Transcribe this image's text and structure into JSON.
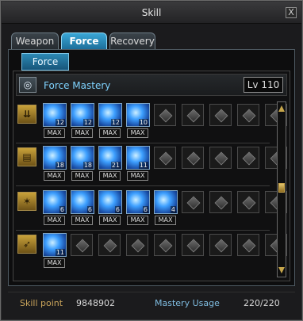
{
  "window": {
    "title": "Skill",
    "close_label": "X"
  },
  "tabs": [
    "Weapon",
    "Force",
    "Recovery"
  ],
  "subtab": "Force",
  "mastery": {
    "name": "Force Mastery",
    "level": "Lv 110"
  },
  "rows": [
    {
      "category_icon": "force-up-icon",
      "skills": [
        {
          "level": "12",
          "max_label": "MAX"
        },
        {
          "level": "12",
          "max_label": "MAX"
        },
        {
          "level": "12",
          "max_label": "MAX"
        },
        {
          "level": "10",
          "max_label": "MAX"
        }
      ]
    },
    {
      "category_icon": "force-book-icon",
      "skills": [
        {
          "level": "18",
          "max_label": "MAX"
        },
        {
          "level": "18",
          "max_label": "MAX"
        },
        {
          "level": "21",
          "max_label": "MAX"
        },
        {
          "level": "11",
          "max_label": "MAX"
        }
      ]
    },
    {
      "category_icon": "force-crest-icon",
      "skills": [
        {
          "level": "6",
          "max_label": "MAX"
        },
        {
          "level": "6",
          "max_label": "MAX"
        },
        {
          "level": "6",
          "max_label": "MAX"
        },
        {
          "level": "6",
          "max_label": "MAX"
        },
        {
          "level": "4",
          "max_label": "MAX"
        }
      ]
    },
    {
      "category_icon": "force-wing-icon",
      "skills": [
        {
          "level": "11",
          "max_label": "MAX"
        }
      ]
    }
  ],
  "footer": {
    "skill_point_label": "Skill point",
    "skill_point_value": "9848902",
    "mastery_usage_label": "Mastery Usage",
    "mastery_usage_value": "220/220"
  },
  "colors": {
    "accent": "#2f8fbf",
    "gold": "#c8a35a",
    "skill_glow": "#3ea0ff"
  }
}
